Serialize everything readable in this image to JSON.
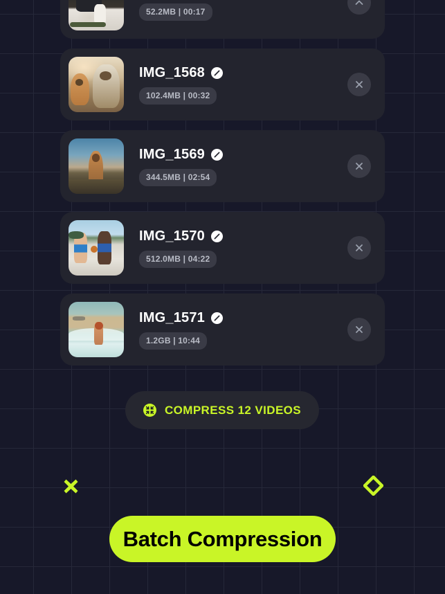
{
  "app": {
    "accent_color": "#c9f527",
    "background_color": "#171829",
    "card_color": "#23242e",
    "badge_color": "#3a3b46"
  },
  "video_list": {
    "items": [
      {
        "name": "",
        "size_duration": "52.2MB | 00:17",
        "thumb_class": "t-skate",
        "thumb_name": "thumbnail-skateboarder",
        "edit_icon": "pencil-icon",
        "remove_icon": "close-icon",
        "cropped": true
      },
      {
        "name": "IMG_1568",
        "size_duration": "102.4MB | 00:32",
        "thumb_class": "t-dogs",
        "thumb_name": "thumbnail-dogs",
        "edit_icon": "pencil-icon",
        "remove_icon": "close-icon",
        "cropped": false
      },
      {
        "name": "IMG_1569",
        "size_duration": "344.5MB | 02:54",
        "thumb_class": "t-desert",
        "thumb_name": "thumbnail-desert-portrait",
        "edit_icon": "pencil-icon",
        "remove_icon": "close-icon",
        "cropped": false
      },
      {
        "name": "IMG_1570",
        "size_duration": "512.0MB | 04:22",
        "thumb_class": "t-ball",
        "thumb_name": "thumbnail-basketball",
        "edit_icon": "pencil-icon",
        "remove_icon": "close-icon",
        "cropped": false
      },
      {
        "name": "IMG_1571",
        "size_duration": "1.2GB | 10:44",
        "thumb_class": "t-beach",
        "thumb_name": "thumbnail-beach-runner",
        "edit_icon": "pencil-icon",
        "remove_icon": "close-icon",
        "cropped": false
      }
    ]
  },
  "compress_action": {
    "label": "COMPRESS 12 VIDEOS",
    "icon": "compress-arrows-icon",
    "video_count": 12
  },
  "decorations": {
    "cross": "cross-shape",
    "diamond": "diamond-outline-shape"
  },
  "banner": {
    "title": "Batch Compression"
  }
}
